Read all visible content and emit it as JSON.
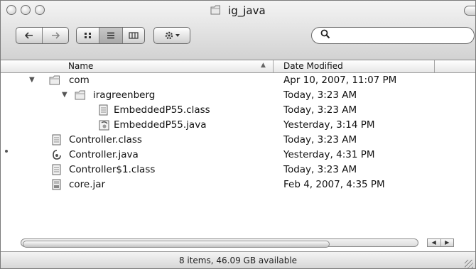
{
  "window": {
    "title": "ig_java"
  },
  "toolbar": {
    "back_icon": "back-arrow-icon",
    "forward_icon": "forward-arrow-icon",
    "view_icon_label": "icon-view",
    "view_list_label": "list-view",
    "view_column_label": "column-view",
    "action_icon": "gear-icon",
    "search_placeholder": ""
  },
  "columns": {
    "name": "Name",
    "date": "Date Modified"
  },
  "items": [
    {
      "name": "com",
      "date": "Apr 10, 2007, 11:07 PM",
      "icon": "folder-icon",
      "expanded": true
    },
    {
      "name": "iragreenberg",
      "date": "Today, 3:23 AM",
      "icon": "folder-icon",
      "expanded": true
    },
    {
      "name": "EmbeddedP55.class",
      "date": "Today, 3:23 AM",
      "icon": "class-file-icon"
    },
    {
      "name": "EmbeddedP55.java",
      "date": "Yesterday, 3:14 PM",
      "icon": "java-file-icon"
    },
    {
      "name": "Controller.class",
      "date": "Today, 3:23 AM",
      "icon": "class-file-icon"
    },
    {
      "name": "Controller.java",
      "date": "Yesterday, 4:31 PM",
      "icon": "java-file-icon"
    },
    {
      "name": "Controller$1.class",
      "date": "Today, 3:23 AM",
      "icon": "class-file-icon"
    },
    {
      "name": "core.jar",
      "date": "Feb 4, 2007, 4:35 PM",
      "icon": "jar-file-icon"
    }
  ],
  "status": {
    "text": "8 items, 46.09 GB available"
  }
}
